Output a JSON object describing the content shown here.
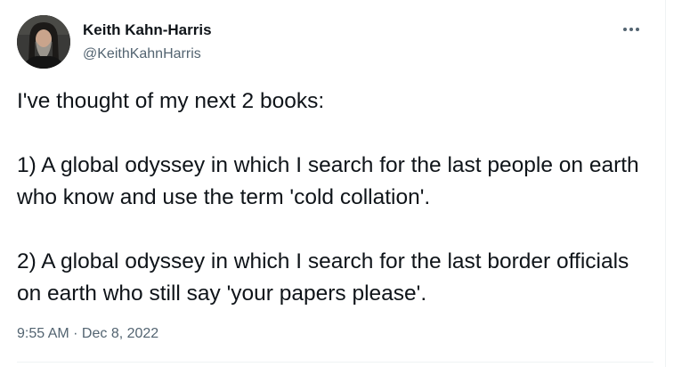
{
  "author": {
    "display_name": "Keith Kahn-Harris",
    "handle": "@KeithKahnHarris",
    "avatar_icon": "profile-photo"
  },
  "menu": {
    "more_icon": "more-horizontal-icon"
  },
  "tweet": {
    "lines": [
      "I've thought of my next 2 books:",
      "1) A global odyssey in which I search for the last people on earth who know and use the term 'cold collation'.",
      "2) A global odyssey in which I search for the last border officials on earth who still say 'your papers please'."
    ],
    "timestamp": "9:55 AM · Dec 8, 2022"
  },
  "colors": {
    "text_primary": "#0f1419",
    "text_secondary": "#536471",
    "divider": "#eff3f4"
  }
}
